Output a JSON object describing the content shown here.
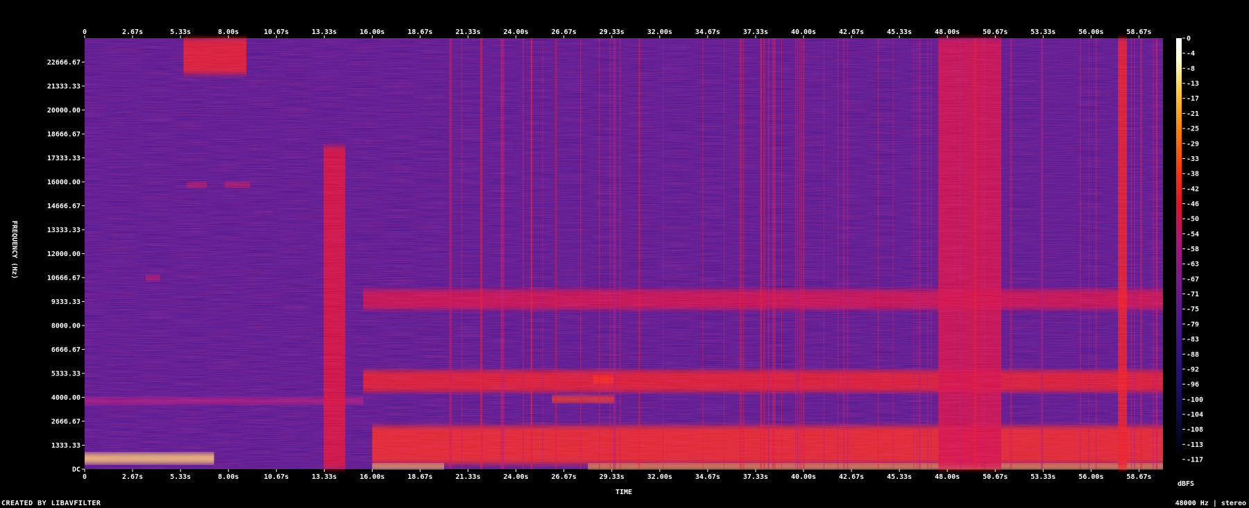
{
  "footer": {
    "created_by": "CREATED BY LIBAVFILTER",
    "format": "48000 Hz | stereo"
  },
  "colors": {
    "background": "#000000",
    "text": "#ffffff",
    "colormap": [
      "#000000",
      "#0b0b45",
      "#2a107a",
      "#4a1590",
      "#7a1890",
      "#b0147a",
      "#e0102a",
      "#ff3010",
      "#ff8000",
      "#ffd040",
      "#ffffd0",
      "#ffffff"
    ]
  },
  "chart_data": {
    "type": "heatmap",
    "title": "",
    "xlabel": "TIME",
    "ylabel": "FREQUENCY (Hz)",
    "colorbar_label": "dBFS",
    "x_ticks": [
      "0",
      "2.67s",
      "5.33s",
      "8.00s",
      "10.67s",
      "13.33s",
      "16.00s",
      "18.67s",
      "21.33s",
      "24.00s",
      "26.67s",
      "29.33s",
      "32.00s",
      "34.67s",
      "37.33s",
      "40.00s",
      "42.67s",
      "45.33s",
      "48.00s",
      "50.67s",
      "53.33s",
      "56.00s",
      "58.67s"
    ],
    "y_ticks": [
      "DC",
      "1333.33",
      "2666.67",
      "4000.00",
      "5333.33",
      "6666.67",
      "8000.00",
      "9333.33",
      "10666.67",
      "12000.00",
      "13333.33",
      "14666.67",
      "16000.00",
      "17333.33",
      "18666.67",
      "20000.00",
      "21333.33",
      "22666.67"
    ],
    "colorbar_ticks": [
      "0",
      "-4",
      "-8",
      "-13",
      "-17",
      "-21",
      "-25",
      "-29",
      "-33",
      "-38",
      "-42",
      "-46",
      "-50",
      "-54",
      "-58",
      "-63",
      "-67",
      "-71",
      "-75",
      "-79",
      "-83",
      "-88",
      "-92",
      "-96",
      "-100",
      "-104",
      "-108",
      "-113",
      "-117"
    ],
    "xlim": [
      0,
      60
    ],
    "ylim": [
      0,
      24000
    ],
    "zlim": [
      -120,
      0
    ],
    "duration_s": 60,
    "sample_rate_hz": 48000,
    "features": [
      {
        "kind": "band",
        "t0": 0,
        "t1": 7.2,
        "f0": 300,
        "f1": 900,
        "db": -18
      },
      {
        "kind": "band",
        "t0": 16.0,
        "t1": 60,
        "f0": 300,
        "f1": 2400,
        "db": -46
      },
      {
        "kind": "band",
        "t0": 15.5,
        "t1": 60,
        "f0": 4300,
        "f1": 5500,
        "db": -50
      },
      {
        "kind": "band",
        "t0": 15.5,
        "t1": 60,
        "f0": 8900,
        "f1": 10000,
        "db": -58
      },
      {
        "kind": "band",
        "t0": 0,
        "t1": 15.5,
        "f0": 3600,
        "f1": 4000,
        "db": -67
      },
      {
        "kind": "band",
        "t0": 13.3,
        "t1": 14.5,
        "f0": 0,
        "f1": 18000,
        "db": -55
      },
      {
        "kind": "band",
        "t0": 16.0,
        "t1": 20.0,
        "f0": 0,
        "f1": 300,
        "db": -20
      },
      {
        "kind": "band",
        "t0": 28.0,
        "t1": 60,
        "f0": 0,
        "f1": 300,
        "db": -25
      },
      {
        "kind": "band",
        "t0": 5.7,
        "t1": 6.8,
        "f0": 15700,
        "f1": 16000,
        "db": -60
      },
      {
        "kind": "band",
        "t0": 7.8,
        "t1": 9.2,
        "f0": 15700,
        "f1": 16000,
        "db": -60
      },
      {
        "kind": "band",
        "t0": 3.4,
        "t1": 4.2,
        "f0": 10500,
        "f1": 10800,
        "db": -62
      },
      {
        "kind": "band",
        "t0": 26.0,
        "t1": 29.5,
        "f0": 3700,
        "f1": 4100,
        "db": -42
      },
      {
        "kind": "band",
        "t0": 28.3,
        "t1": 29.5,
        "f0": 4800,
        "f1": 5200,
        "db": -44
      },
      {
        "kind": "band",
        "t0": 5.5,
        "t1": 9.0,
        "f0": 22000,
        "f1": 24000,
        "db": -50
      },
      {
        "kind": "band",
        "t0": 47.5,
        "t1": 51.0,
        "f0": 0,
        "f1": 24000,
        "db": -58
      },
      {
        "kind": "band",
        "t0": 57.5,
        "t1": 58.0,
        "f0": 0,
        "f1": 24000,
        "db": -50
      }
    ]
  }
}
